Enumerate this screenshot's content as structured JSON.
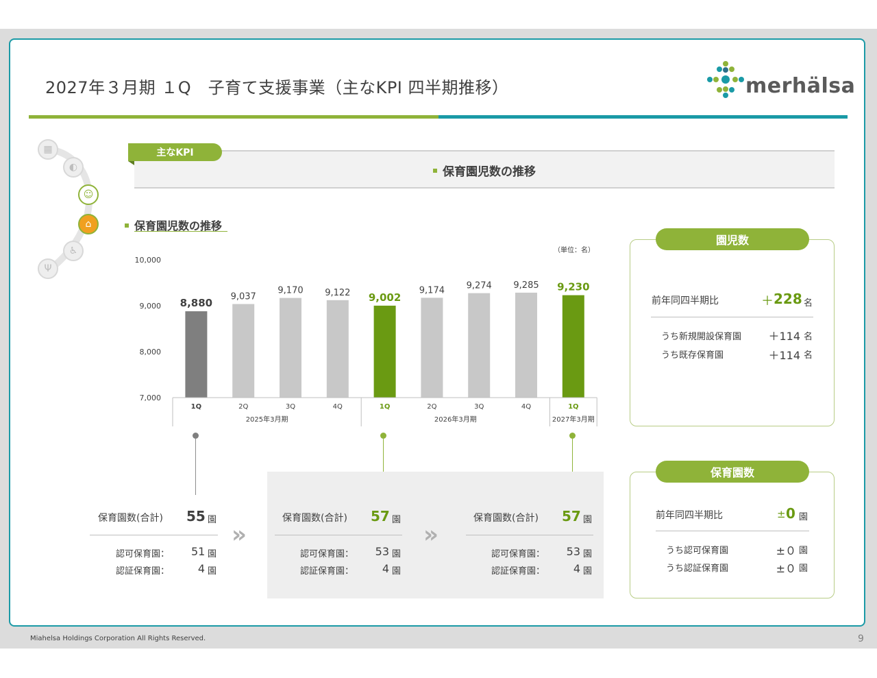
{
  "title": "2027年３月期 １Q　子育て支援事業（主なKPI 四半期推移）",
  "logo": {
    "text": "merhälsa"
  },
  "colors": {
    "green": "#8fb339",
    "green_dark": "#6a9a12",
    "teal": "#1a9aa6",
    "gray_bar": "#c8c8c8",
    "dark_bar": "#7f7f7f"
  },
  "kpi_tab": "主なKPI",
  "banner_title": "保育園児数の推移",
  "section_title": "保育園児数の推移",
  "unit_note": "（単位：名）",
  "side_icons": [
    "building-icon",
    "capsule-icon",
    "child-face-icon",
    "nursery-icon",
    "wheelchair-icon",
    "cutlery-icon"
  ],
  "chart_data": {
    "type": "bar",
    "categories": [
      "1Q",
      "2Q",
      "3Q",
      "4Q",
      "1Q",
      "2Q",
      "3Q",
      "4Q",
      "1Q"
    ],
    "values": [
      8880,
      9037,
      9170,
      9122,
      9002,
      9174,
      9274,
      9285,
      9230
    ],
    "value_labels": [
      "8,880",
      "9,037",
      "9,170",
      "9,122",
      "9,002",
      "9,174",
      "9,274",
      "9,285",
      "9,230"
    ],
    "groups": [
      {
        "label": "2025年3月期",
        "count": 4
      },
      {
        "label": "2026年3月期",
        "count": 4
      },
      {
        "label": "2027年3月期",
        "count": 1
      }
    ],
    "highlight": [
      "dark",
      "normal",
      "normal",
      "normal",
      "green",
      "normal",
      "normal",
      "normal",
      "green"
    ],
    "ylim": [
      7000,
      10000
    ],
    "yticks": [
      7000,
      8000,
      9000,
      10000
    ],
    "ytick_labels": [
      "7,000",
      "8,000",
      "9,000",
      "10,000"
    ]
  },
  "snapshots": [
    {
      "total_label": "保育園数(合計)",
      "total_value": "55",
      "unit": "園",
      "rows": [
        {
          "label": "認可保育園：",
          "value": "51",
          "unit": "園"
        },
        {
          "label": "認証保育園：",
          "value": "4",
          "unit": "園"
        }
      ]
    },
    {
      "total_label": "保育園数(合計)",
      "total_value": "57",
      "unit": "園",
      "rows": [
        {
          "label": "認可保育園：",
          "value": "53",
          "unit": "園"
        },
        {
          "label": "認証保育園：",
          "value": "4",
          "unit": "園"
        }
      ]
    },
    {
      "total_label": "保育園数(合計)",
      "total_value": "57",
      "unit": "園",
      "rows": [
        {
          "label": "認可保育園：",
          "value": "53",
          "unit": "園"
        },
        {
          "label": "認証保育園：",
          "value": "4",
          "unit": "園"
        }
      ]
    }
  ],
  "chevron": "»",
  "panel_children": {
    "title": "園児数",
    "yoy_label": "前年同四半期比",
    "yoy_sign": "＋",
    "yoy_value": "228",
    "yoy_unit": "名",
    "rows": [
      {
        "label": "うち新規開設保育園",
        "value": "＋114",
        "unit": "名"
      },
      {
        "label": "うち既存保育園",
        "value": "＋114",
        "unit": "名"
      }
    ]
  },
  "panel_nurseries": {
    "title": "保育園数",
    "yoy_label": "前年同四半期比",
    "yoy_sign": "±",
    "yoy_value": "0",
    "yoy_unit": "園",
    "rows": [
      {
        "label": "うち認可保育園",
        "value": "±０",
        "unit": "園"
      },
      {
        "label": "うち認証保育園",
        "value": "±０",
        "unit": "園"
      }
    ]
  },
  "footer": "Miahelsa Holdings Corporation All Rights Reserved.",
  "page_number": "9"
}
